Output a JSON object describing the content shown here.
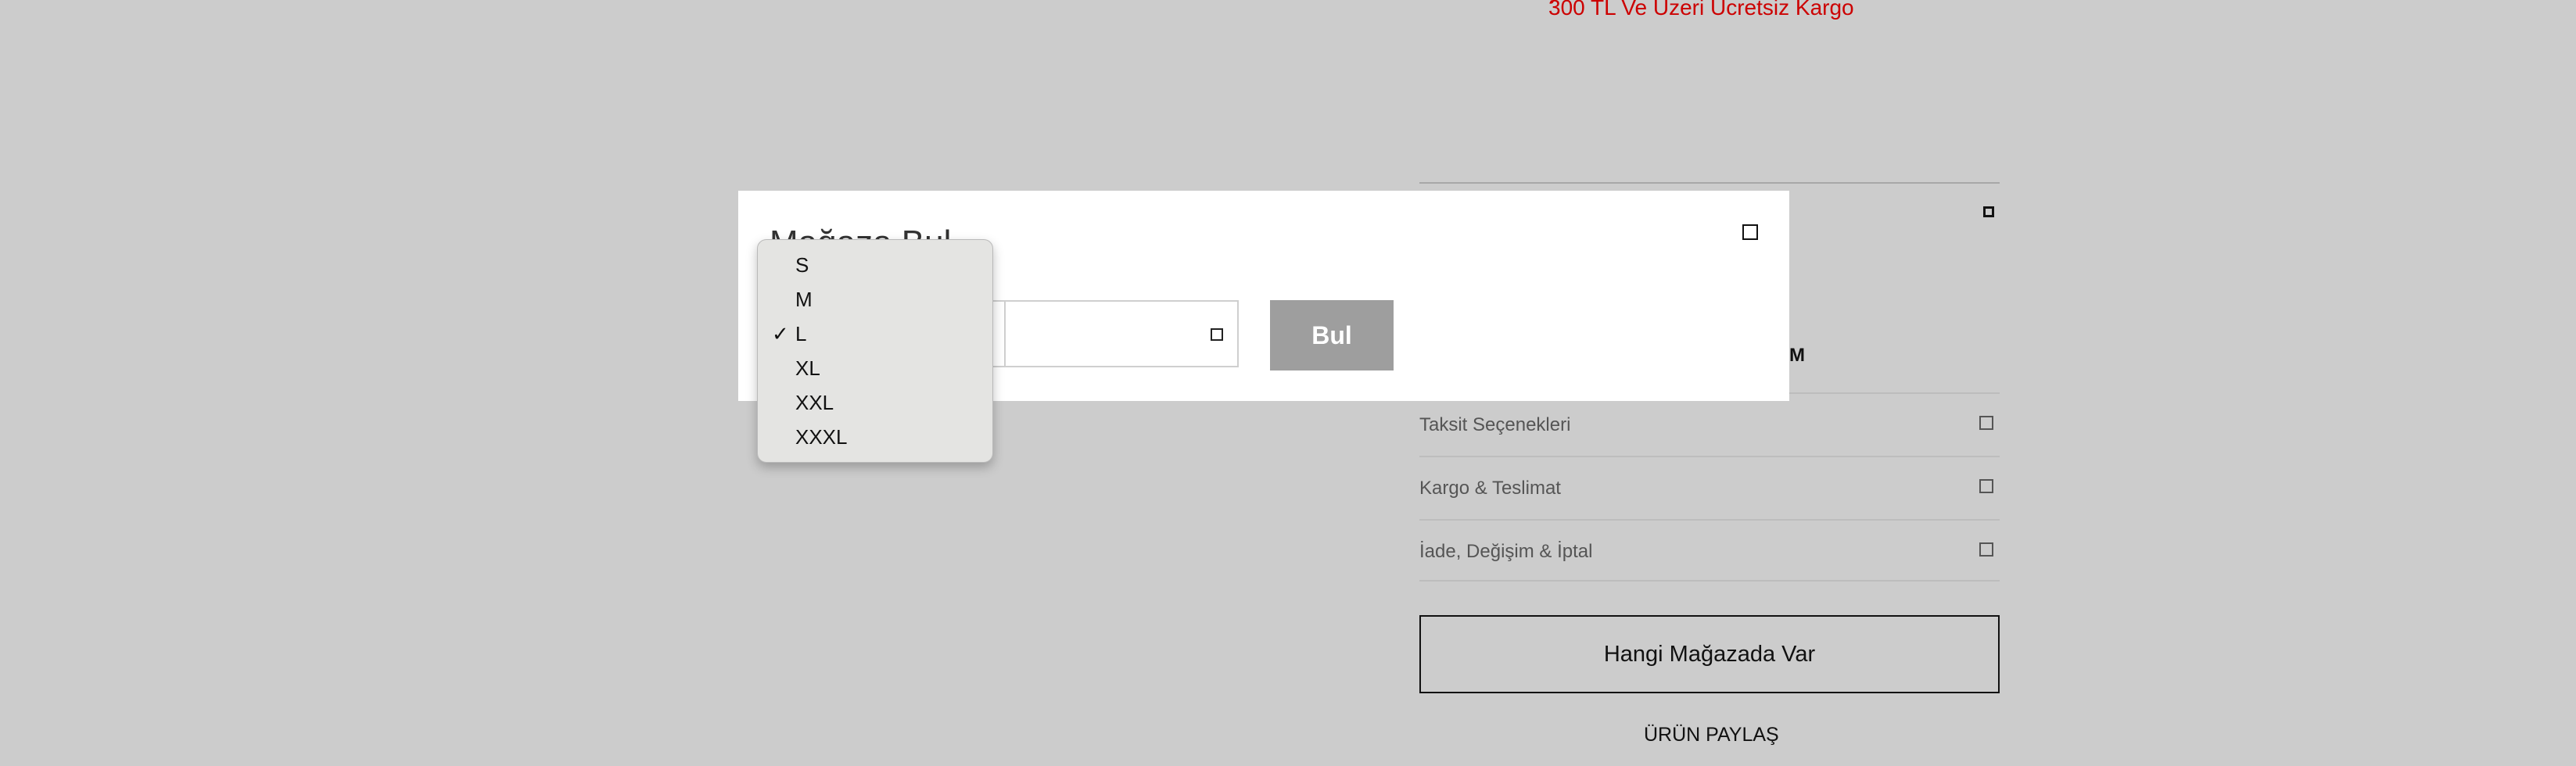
{
  "promo": {
    "text": "300 TL Ve Üzeri Ücretsiz Kargo",
    "tick": "✓"
  },
  "product_panel": {
    "selected_size_chip": "M",
    "accordions": [
      {
        "label": "Taksit Seçenekleri"
      },
      {
        "label": "Kargo & Teslimat"
      },
      {
        "label": "İade, Değişim & İptal"
      }
    ],
    "store_button": "Hangi Mağazada Var",
    "share_label": "ÜRÜN PAYLAŞ"
  },
  "modal": {
    "title": "Mağaza Bul",
    "find_button": "Bul"
  },
  "size_dropdown": {
    "options": [
      "S",
      "M",
      "L",
      "XL",
      "XXL",
      "XXXL"
    ],
    "selected": "L",
    "check_glyph": "✓"
  },
  "colors": {
    "overlay_bg": "#cccccc",
    "promo_red": "#cc0000",
    "find_button_bg": "#9e9e9e"
  }
}
